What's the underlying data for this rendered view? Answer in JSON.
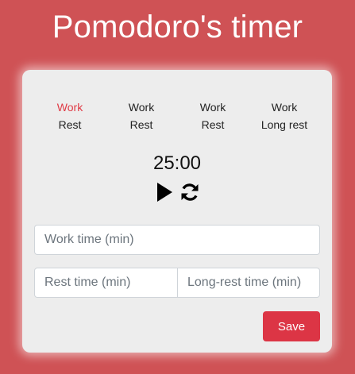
{
  "app": {
    "title": "Pomodoro's timer"
  },
  "cycle": [
    {
      "work": "Work",
      "rest": "Rest",
      "active": true
    },
    {
      "work": "Work",
      "rest": "Rest",
      "active": false
    },
    {
      "work": "Work",
      "rest": "Rest",
      "active": false
    },
    {
      "work": "Work",
      "rest": "Long rest",
      "active": false
    }
  ],
  "timer": {
    "display": "25:00",
    "controls": [
      "play-icon",
      "refresh-icon"
    ]
  },
  "settings": {
    "work_placeholder": "Work time (min)",
    "rest_placeholder": "Rest time (min)",
    "longrest_placeholder": "Long-rest time (min)",
    "work_value": "",
    "rest_value": "",
    "longrest_value": ""
  },
  "actions": {
    "save_label": "Save"
  },
  "colors": {
    "background": "#cf5255",
    "card": "#ededed",
    "accent": "#dc3545",
    "active_phase": "#e03a45"
  }
}
